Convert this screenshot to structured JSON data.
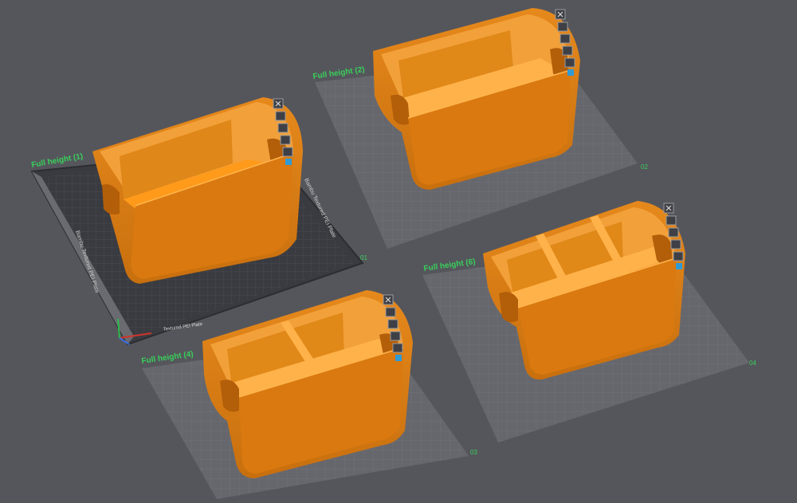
{
  "app": {
    "background": "#55565c",
    "accent": "#f7941d",
    "label_color": "#38d05a"
  },
  "plates": [
    {
      "id": "plate-1",
      "title": "Full height (1)",
      "number": "01",
      "bed_text": "Textured PEI Plate",
      "side_text": "Bambu Textured PEI Plate",
      "dividers": "none",
      "selected": true
    },
    {
      "id": "plate-2",
      "title": "Full height (2)",
      "number": "02",
      "dividers": "1 lengthwise"
    },
    {
      "id": "plate-3",
      "title": "Full height (4)",
      "number": "03",
      "dividers": "2 x 2"
    },
    {
      "id": "plate-4",
      "title": "Full height (6)",
      "number": "04",
      "dividers": "3 x 2"
    }
  ],
  "plate_toolbar": {
    "icons": [
      "close-icon",
      "arrange-icon",
      "orient-icon",
      "lock-icon",
      "settings-icon",
      "slice-icon"
    ]
  }
}
